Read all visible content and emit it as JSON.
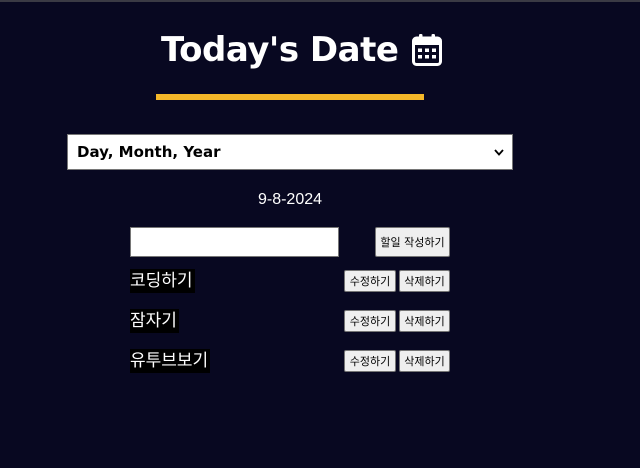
{
  "header": {
    "title": "Today's Date",
    "icon": "calendar-icon"
  },
  "colors": {
    "background": "#080821",
    "accent_bar": "#f4b729",
    "text": "#ffffff"
  },
  "date_format": {
    "selected": "Day, Month, Year",
    "icon": "chevron-down-icon"
  },
  "date_display": "9-8-2024",
  "todo_form": {
    "input_value": "",
    "add_button_label": "할일 작성하기"
  },
  "todos": [
    {
      "text": "코딩하기",
      "edit_label": "수정하기",
      "delete_label": "삭제하기"
    },
    {
      "text": "잠자기",
      "edit_label": "수정하기",
      "delete_label": "삭제하기"
    },
    {
      "text": "유투브보기",
      "edit_label": "수정하기",
      "delete_label": "삭제하기"
    }
  ]
}
